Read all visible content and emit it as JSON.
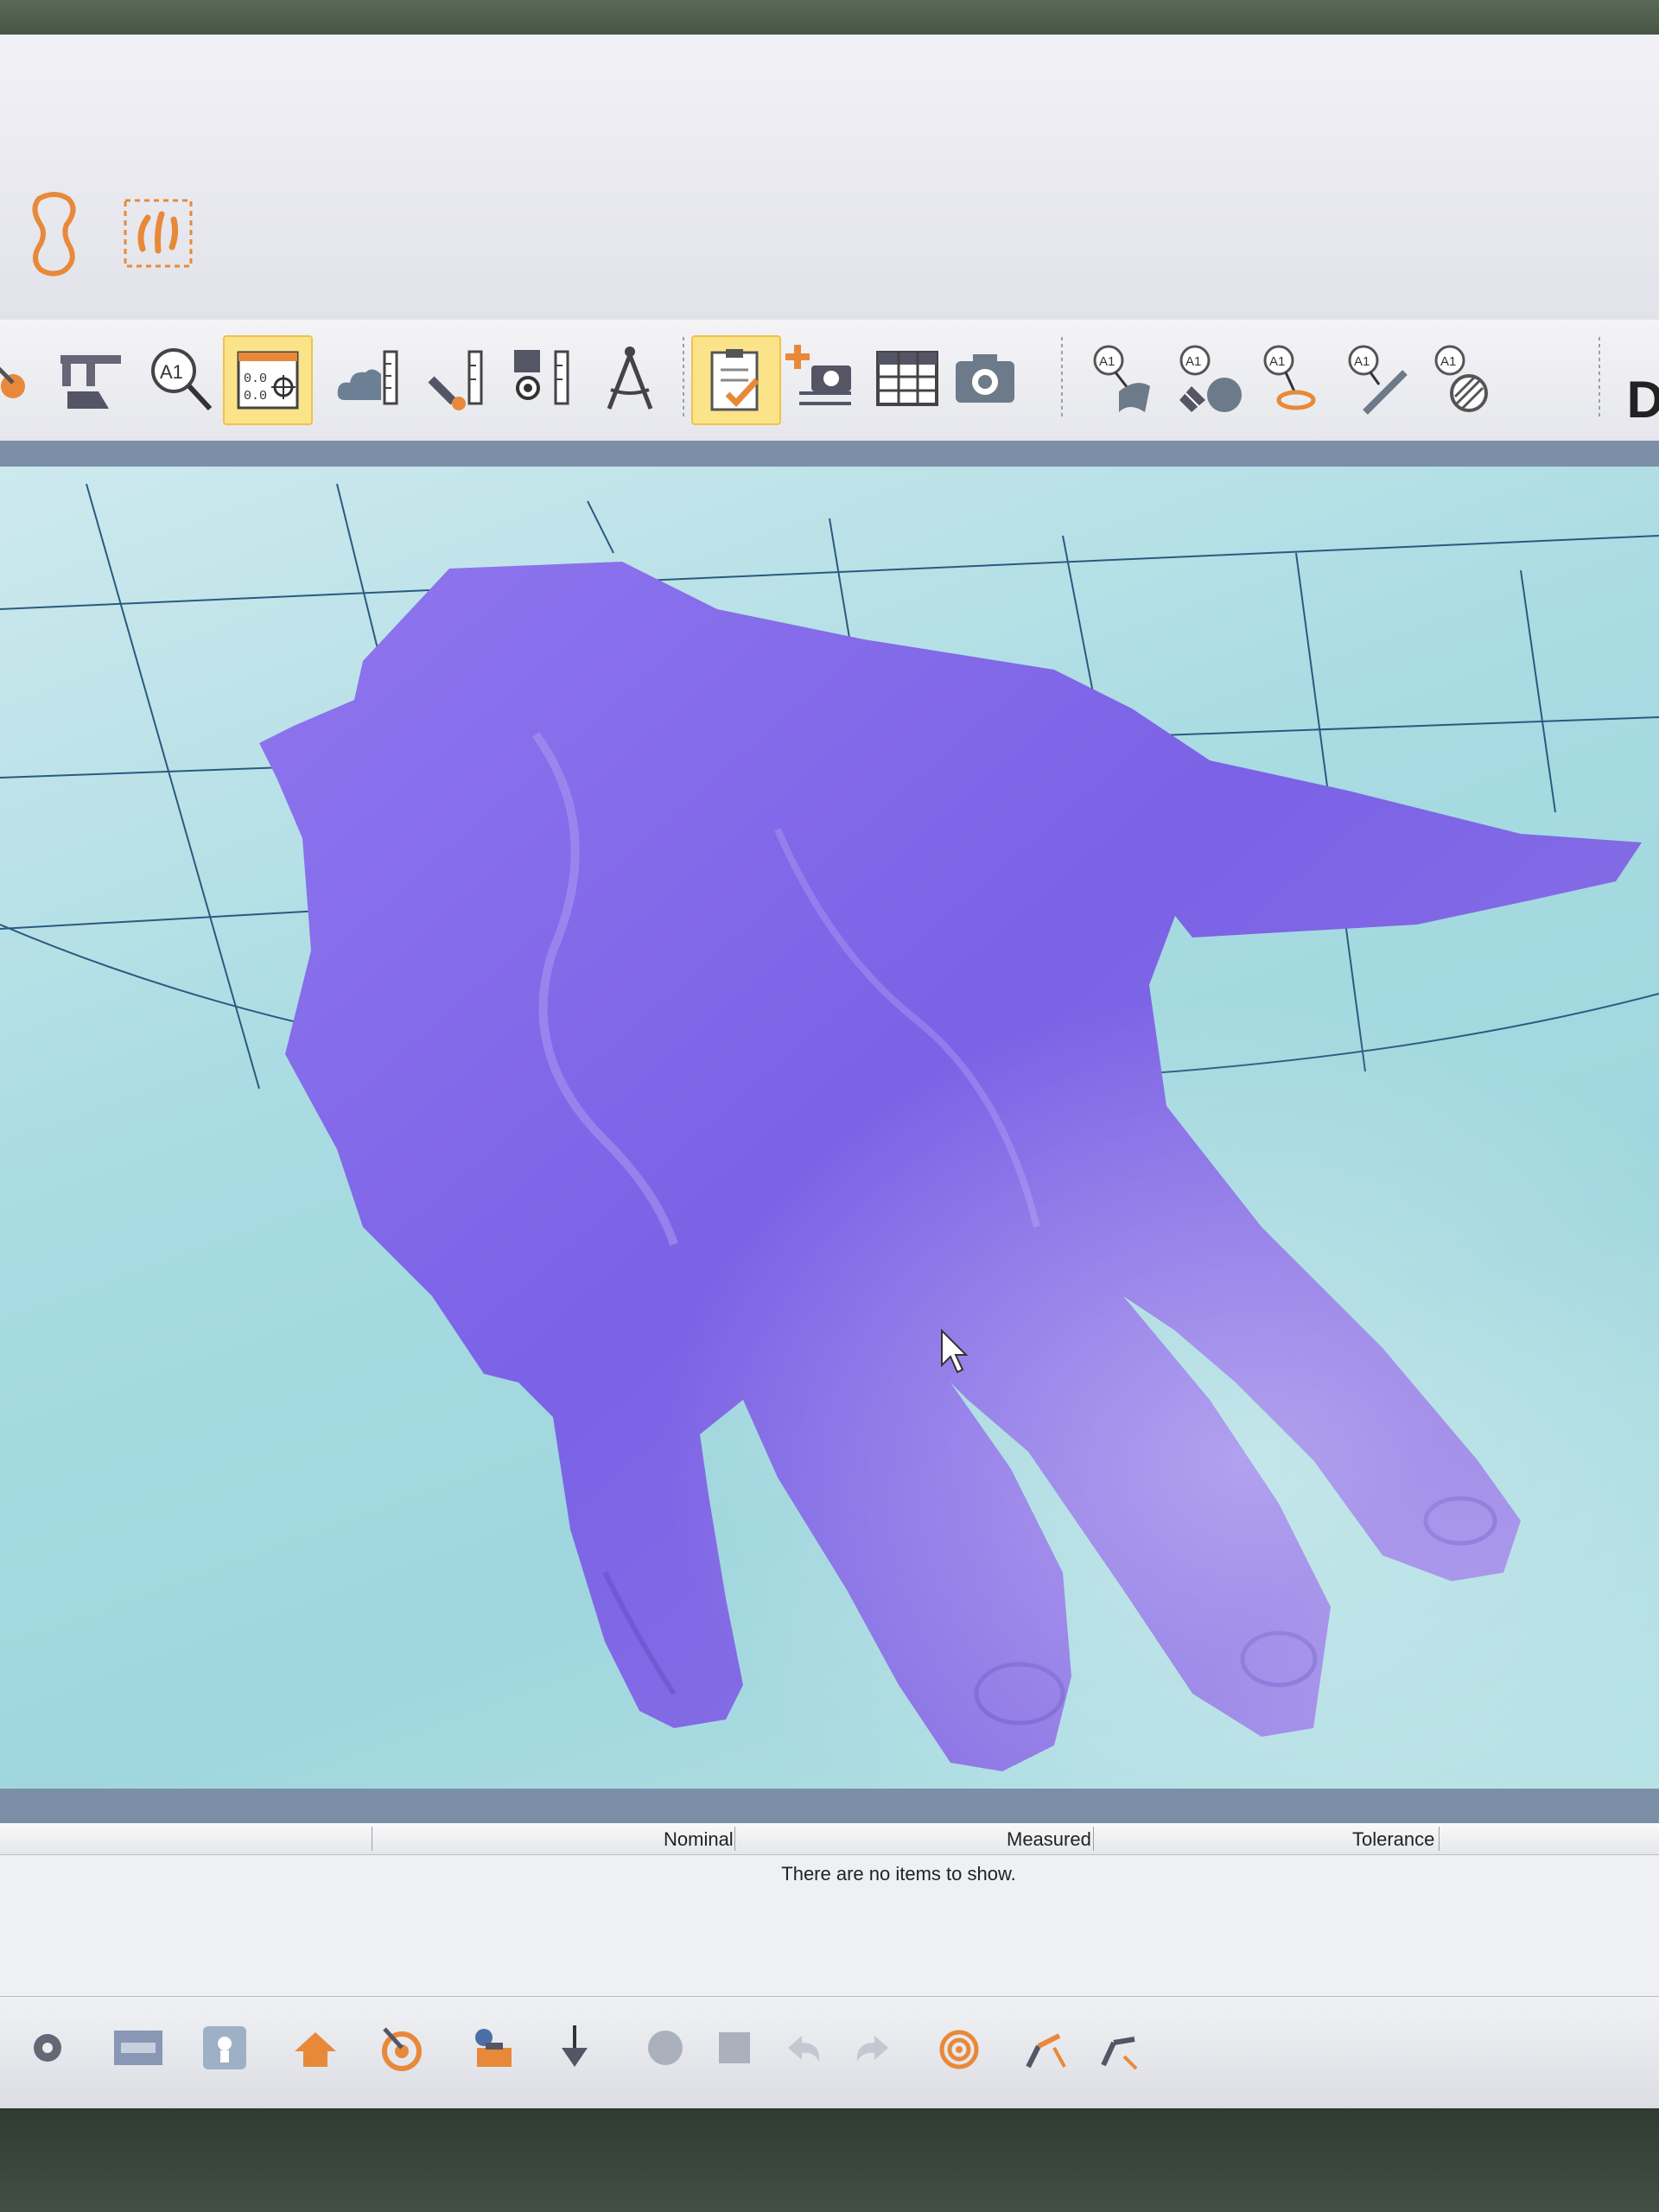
{
  "window": {
    "ribbon_partial_letter": "D"
  },
  "toolbar": {
    "tools": [
      {
        "name": "probe-tool",
        "icon": "probe-icon"
      },
      {
        "name": "caliper-tool",
        "icon": "caliper-icon"
      },
      {
        "name": "annotation-zoom-tool",
        "icon": "annotation-zoom-icon"
      },
      {
        "name": "coordinate-display-tool",
        "icon": "coordinate-target-icon",
        "active": true
      },
      {
        "name": "cloud-measure-tool",
        "icon": "cloud-ruler-icon"
      },
      {
        "name": "point-measure-tool",
        "icon": "point-ruler-icon"
      },
      {
        "name": "feature-measure-tool",
        "icon": "feature-ruler-icon"
      },
      {
        "name": "compass-tool",
        "icon": "compass-icon"
      },
      {
        "name": "checklist-tool",
        "icon": "checklist-icon",
        "active": true
      },
      {
        "name": "add-capture-tool",
        "icon": "add-camera-icon"
      },
      {
        "name": "table-tool",
        "icon": "table-icon"
      },
      {
        "name": "camera-tool",
        "icon": "camera-icon"
      },
      {
        "name": "annotate-surface-tool",
        "icon": "annotate-surface-icon"
      },
      {
        "name": "annotate-grid-tool",
        "icon": "annotate-grid-icon"
      },
      {
        "name": "annotate-point-tool",
        "icon": "annotate-point-icon"
      },
      {
        "name": "annotate-line-tool",
        "icon": "annotate-line-icon"
      },
      {
        "name": "annotate-section-tool",
        "icon": "annotate-section-icon"
      }
    ]
  },
  "results_table": {
    "columns": [
      "Nominal",
      "Measured",
      "Tolerance"
    ],
    "empty_message": "There are no items to show."
  },
  "colors": {
    "mesh": "#7b62e6",
    "viewport": "#a8dbe2",
    "accent": "#e8893a",
    "active_tool": "#fbe38a"
  }
}
